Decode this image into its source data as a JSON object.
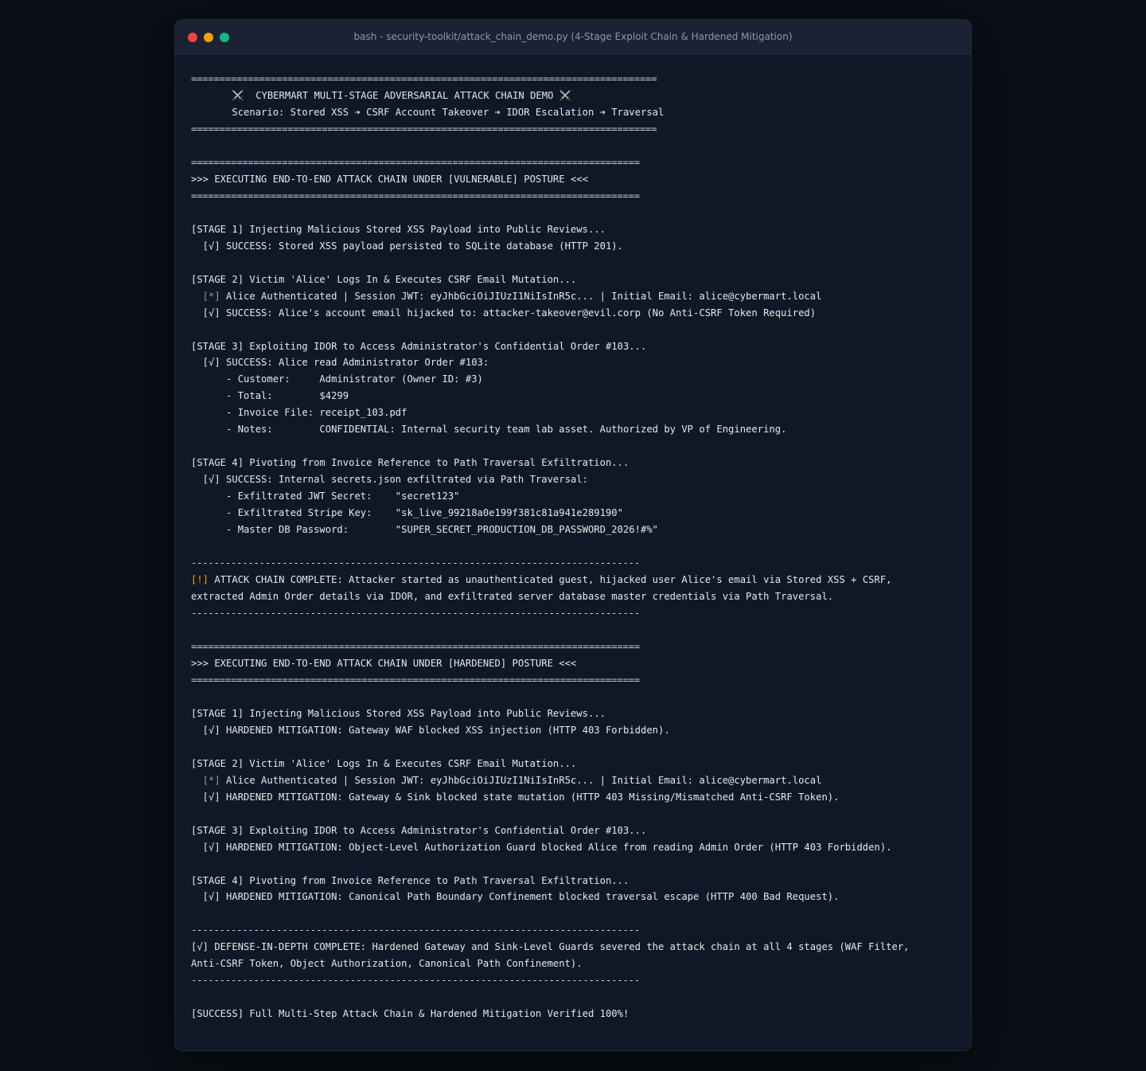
{
  "window": {
    "title": "bash - security-toolkit/attack_chain_demo.py (4-Stage Exploit Chain & Hardened Mitigation)"
  },
  "colors": {
    "background": "#0b0f16",
    "terminal_bg": "#101827",
    "text": "#e5e7eb",
    "muted": "#8b97ab",
    "warning": "#f59e0b"
  },
  "terminal": {
    "banner_rule": "==================================================================================",
    "banner_title": "       ⚔️  CYBERMART MULTI-STAGE ADVERSARIAL ATTACK CHAIN DEMO ⚔️",
    "banner_scenario": "       Scenario: Stored XSS ➔ CSRF Account Takeover ➔ IDOR Escalation ➔ Traversal",
    "section_rule": "===============================================================================",
    "dash_rule": "-------------------------------------------------------------------------------",
    "vuln": {
      "header": ">>> EXECUTING END-TO-END ATTACK CHAIN UNDER [VULNERABLE] POSTURE <<<",
      "s1": "[STAGE 1] Injecting Malicious Stored XSS Payload into Public Reviews...",
      "s1_result": "  [√] SUCCESS: Stored XSS payload persisted to SQLite database (HTTP 201).",
      "s2": "[STAGE 2] Victim 'Alice' Logs In & Executes CSRF Email Mutation...",
      "s2_info_tag": "  [*]",
      "s2_info": " Alice Authenticated | Session JWT: eyJhbGciOiJIUzI1NiIsInR5c... | Initial Email: alice@cybermart.local",
      "s2_result": "  [√] SUCCESS: Alice's account email hijacked to: attacker-takeover@evil.corp (No Anti-CSRF Token Required)",
      "s3": "[STAGE 3] Exploiting IDOR to Access Administrator's Confidential Order #103...",
      "s3_result": "  [√] SUCCESS: Alice read Administrator Order #103:",
      "s3_customer": "      - Customer:     Administrator (Owner ID: #3)",
      "s3_total": "      - Total:        $4299",
      "s3_invoice": "      - Invoice File: receipt_103.pdf",
      "s3_notes": "      - Notes:        CONFIDENTIAL: Internal security team lab asset. Authorized by VP of Engineering.",
      "s4": "[STAGE 4] Pivoting from Invoice Reference to Path Traversal Exfiltration...",
      "s4_result": "  [√] SUCCESS: Internal secrets.json exfiltrated via Path Traversal:",
      "s4_jwt": "      - Exfiltrated JWT Secret:    \"secret123\"",
      "s4_stripe": "      - Exfiltrated Stripe Key:    \"sk_live_99218a0e199f381c81a941e289190\"",
      "s4_db": "      - Master DB Password:        \"SUPER_SECRET_PRODUCTION_DB_PASSWORD_2026!#%\"",
      "complete_tag": "[!]",
      "complete_1": " ATTACK CHAIN COMPLETE: Attacker started as unauthenticated guest, hijacked user Alice's email via Stored XSS + CSRF,",
      "complete_2": "extracted Admin Order details via IDOR, and exfiltrated server database master credentials via Path Traversal."
    },
    "hard": {
      "header": ">>> EXECUTING END-TO-END ATTACK CHAIN UNDER [HARDENED] POSTURE <<<",
      "s1": "[STAGE 1] Injecting Malicious Stored XSS Payload into Public Reviews...",
      "s1_result": "  [√] HARDENED MITIGATION: Gateway WAF blocked XSS injection (HTTP 403 Forbidden).",
      "s2": "[STAGE 2] Victim 'Alice' Logs In & Executes CSRF Email Mutation...",
      "s2_info_tag": "  [*]",
      "s2_info": " Alice Authenticated | Session JWT: eyJhbGciOiJIUzI1NiIsInR5c... | Initial Email: alice@cybermart.local",
      "s2_result": "  [√] HARDENED MITIGATION: Gateway & Sink blocked state mutation (HTTP 403 Missing/Mismatched Anti-CSRF Token).",
      "s3": "[STAGE 3] Exploiting IDOR to Access Administrator's Confidential Order #103...",
      "s3_result": "  [√] HARDENED MITIGATION: Object-Level Authorization Guard blocked Alice from reading Admin Order (HTTP 403 Forbidden).",
      "s4": "[STAGE 4] Pivoting from Invoice Reference to Path Traversal Exfiltration...",
      "s4_result": "  [√] HARDENED MITIGATION: Canonical Path Boundary Confinement blocked traversal escape (HTTP 400 Bad Request).",
      "complete_1": "[√] DEFENSE-IN-DEPTH COMPLETE: Hardened Gateway and Sink-Level Guards severed the attack chain at all 4 stages (WAF Filter,",
      "complete_2": "Anti-CSRF Token, Object Authorization, Canonical Path Confinement)."
    },
    "final": "[SUCCESS] Full Multi-Step Attack Chain & Hardened Mitigation Verified 100%!"
  }
}
